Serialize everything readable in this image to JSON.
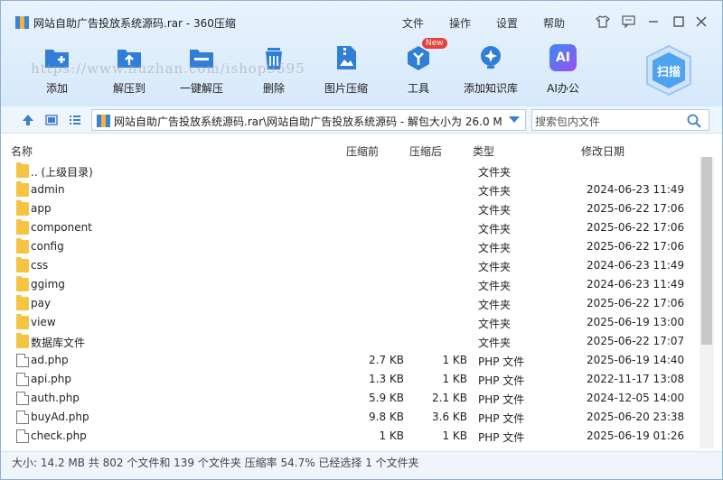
{
  "window": {
    "title": "网站自助广告投放系统源码.rar - 360压缩",
    "menu": [
      "文件",
      "操作",
      "设置",
      "帮助"
    ]
  },
  "toolbar": {
    "items": [
      {
        "label": "添加",
        "icon": "add-icon"
      },
      {
        "label": "解压到",
        "icon": "extract-to-icon"
      },
      {
        "label": "一键解压",
        "icon": "one-click-extract-icon"
      },
      {
        "label": "删除",
        "icon": "delete-icon"
      },
      {
        "label": "图片压缩",
        "icon": "image-compress-icon"
      },
      {
        "label": "工具",
        "icon": "tools-icon",
        "badge": "New"
      },
      {
        "label": "添加知识库",
        "icon": "knowledge-base-icon"
      },
      {
        "label": "AI办公",
        "icon": "ai-office-icon",
        "icon_text": "AI"
      }
    ],
    "scan_label": "扫描",
    "watermark": "https://www.huzhan.com/ishop9595"
  },
  "address": {
    "path": "网站自助广告投放系统源码.rar\\网站自助广告投放系统源码 - 解包大小为 26.0 M",
    "search_placeholder": "搜索包内文件"
  },
  "columns": {
    "name": "名称",
    "size": "压缩前",
    "packed": "压缩后",
    "type": "类型",
    "modified": "修改日期"
  },
  "rows": [
    {
      "name": ".. (上级目录)",
      "size": "",
      "packed": "",
      "type": "文件夹",
      "date": "",
      "kind": "folder"
    },
    {
      "name": "admin",
      "size": "",
      "packed": "",
      "type": "文件夹",
      "date": "2024-06-23 11:49",
      "kind": "folder"
    },
    {
      "name": "app",
      "size": "",
      "packed": "",
      "type": "文件夹",
      "date": "2025-06-22 17:06",
      "kind": "folder"
    },
    {
      "name": "component",
      "size": "",
      "packed": "",
      "type": "文件夹",
      "date": "2025-06-22 17:06",
      "kind": "folder"
    },
    {
      "name": "config",
      "size": "",
      "packed": "",
      "type": "文件夹",
      "date": "2025-06-22 17:06",
      "kind": "folder"
    },
    {
      "name": "css",
      "size": "",
      "packed": "",
      "type": "文件夹",
      "date": "2024-06-23 11:49",
      "kind": "folder"
    },
    {
      "name": "ggimg",
      "size": "",
      "packed": "",
      "type": "文件夹",
      "date": "2024-06-23 11:49",
      "kind": "folder"
    },
    {
      "name": "pay",
      "size": "",
      "packed": "",
      "type": "文件夹",
      "date": "2025-06-22 17:06",
      "kind": "folder"
    },
    {
      "name": "view",
      "size": "",
      "packed": "",
      "type": "文件夹",
      "date": "2025-06-19 13:00",
      "kind": "folder"
    },
    {
      "name": "数据库文件",
      "size": "",
      "packed": "",
      "type": "文件夹",
      "date": "2025-06-22 17:07",
      "kind": "folder"
    },
    {
      "name": "ad.php",
      "size": "2.7 KB",
      "packed": "1 KB",
      "type": "PHP 文件",
      "date": "2025-06-19 14:40",
      "kind": "file"
    },
    {
      "name": "api.php",
      "size": "1.3 KB",
      "packed": "1 KB",
      "type": "PHP 文件",
      "date": "2022-11-17 13:08",
      "kind": "file"
    },
    {
      "name": "auth.php",
      "size": "5.9 KB",
      "packed": "2.1 KB",
      "type": "PHP 文件",
      "date": "2024-12-05 14:00",
      "kind": "file"
    },
    {
      "name": "buyAd.php",
      "size": "9.8 KB",
      "packed": "3.6 KB",
      "type": "PHP 文件",
      "date": "2025-06-20 23:38",
      "kind": "file"
    },
    {
      "name": "check.php",
      "size": "1 KB",
      "packed": "1 KB",
      "type": "PHP 文件",
      "date": "2025-06-19 01:26",
      "kind": "file"
    }
  ],
  "status": "大小: 14.2 MB 共 802 个文件和 139 个文件夹 压缩率 54.7% 已经选择 1 个文件夹",
  "colors": {
    "accent": "#2f7fd8",
    "folder": "#f6c443",
    "badge": "#e8413c"
  }
}
